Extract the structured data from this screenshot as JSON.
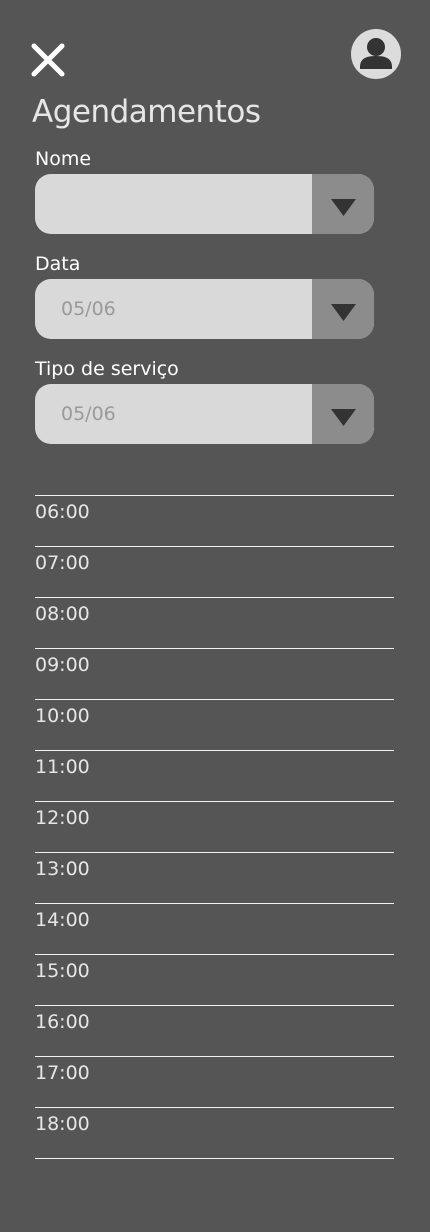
{
  "header": {
    "title": "Agendamentos",
    "close_icon": "close-icon",
    "avatar_icon": "user-icon"
  },
  "form": {
    "name": {
      "label": "Nome",
      "value": ""
    },
    "date": {
      "label": "Data",
      "value": "05/06"
    },
    "service": {
      "label": "Tipo de serviço",
      "value": "05/06"
    }
  },
  "schedule": {
    "times": [
      "06:00",
      "07:00",
      "08:00",
      "09:00",
      "10:00",
      "11:00",
      "12:00",
      "13:00",
      "14:00",
      "15:00",
      "16:00",
      "17:00",
      "18:00"
    ]
  },
  "colors": {
    "background": "#555555",
    "input": "#d9d9d9",
    "dropdown_button": "#8c8c8c",
    "text": "#ffffff",
    "placeholder": "#9a9a9a"
  }
}
